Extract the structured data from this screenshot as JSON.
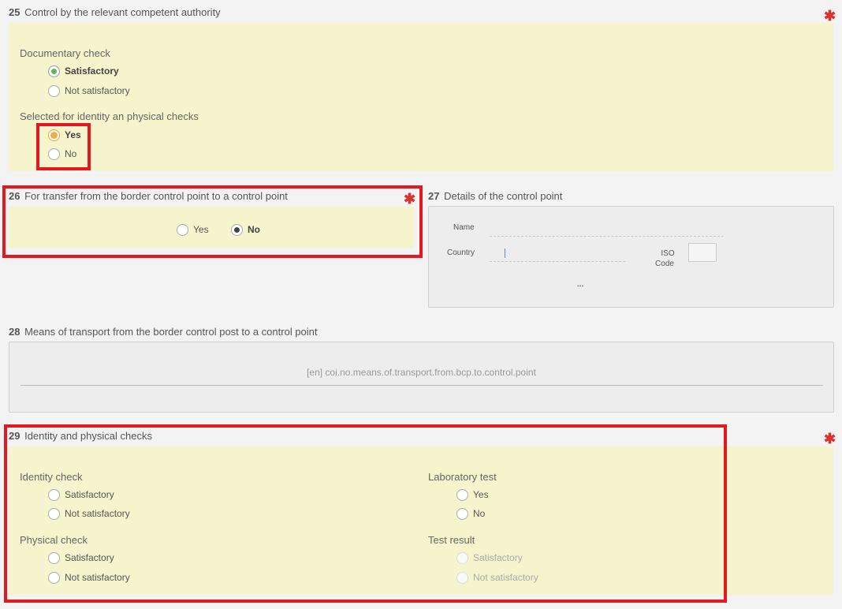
{
  "sec25": {
    "num": "25",
    "title": "Control by the relevant competent authority",
    "documentary_label": "Documentary check",
    "doc_opt1": "Satisfactory",
    "doc_opt2": "Not satisfactory",
    "identity_label": "Selected for identity an physical checks",
    "id_opt1": "Yes",
    "id_opt2": "No"
  },
  "sec26": {
    "num": "26",
    "title": "For transfer from the border control point to a control point",
    "opt1": "Yes",
    "opt2": "No"
  },
  "sec27": {
    "num": "27",
    "title": "Details of the control point",
    "name_label": "Name",
    "country_label": "Country",
    "iso_label_1": "ISO",
    "iso_label_2": "Code",
    "more": "•••"
  },
  "sec28": {
    "num": "28",
    "title": "Means of transport from the border control post to a control point",
    "placeholder": "[en] coi.no.means.of.transport.from.bcp.to.control.point"
  },
  "sec29": {
    "num": "29",
    "title": "Identity and physical checks",
    "identity_label": "Identity check",
    "identity_opt1": "Satisfactory",
    "identity_opt2": "Not satisfactory",
    "physical_label": "Physical check",
    "physical_opt1": "Satisfactory",
    "physical_opt2": "Not satisfactory",
    "lab_label": "Laboratory test",
    "lab_opt1": "Yes",
    "lab_opt2": "No",
    "result_label": "Test result",
    "result_opt1": "Satisfactory",
    "result_opt2": "Not satisfactory"
  },
  "required_mark": "✱",
  "colors": {
    "panel": "#f5f4cc",
    "highlight": "#e3191f",
    "required": "#d9322f",
    "selected_green": "#5cb85c",
    "selected_orange": "#f0ad4e"
  }
}
